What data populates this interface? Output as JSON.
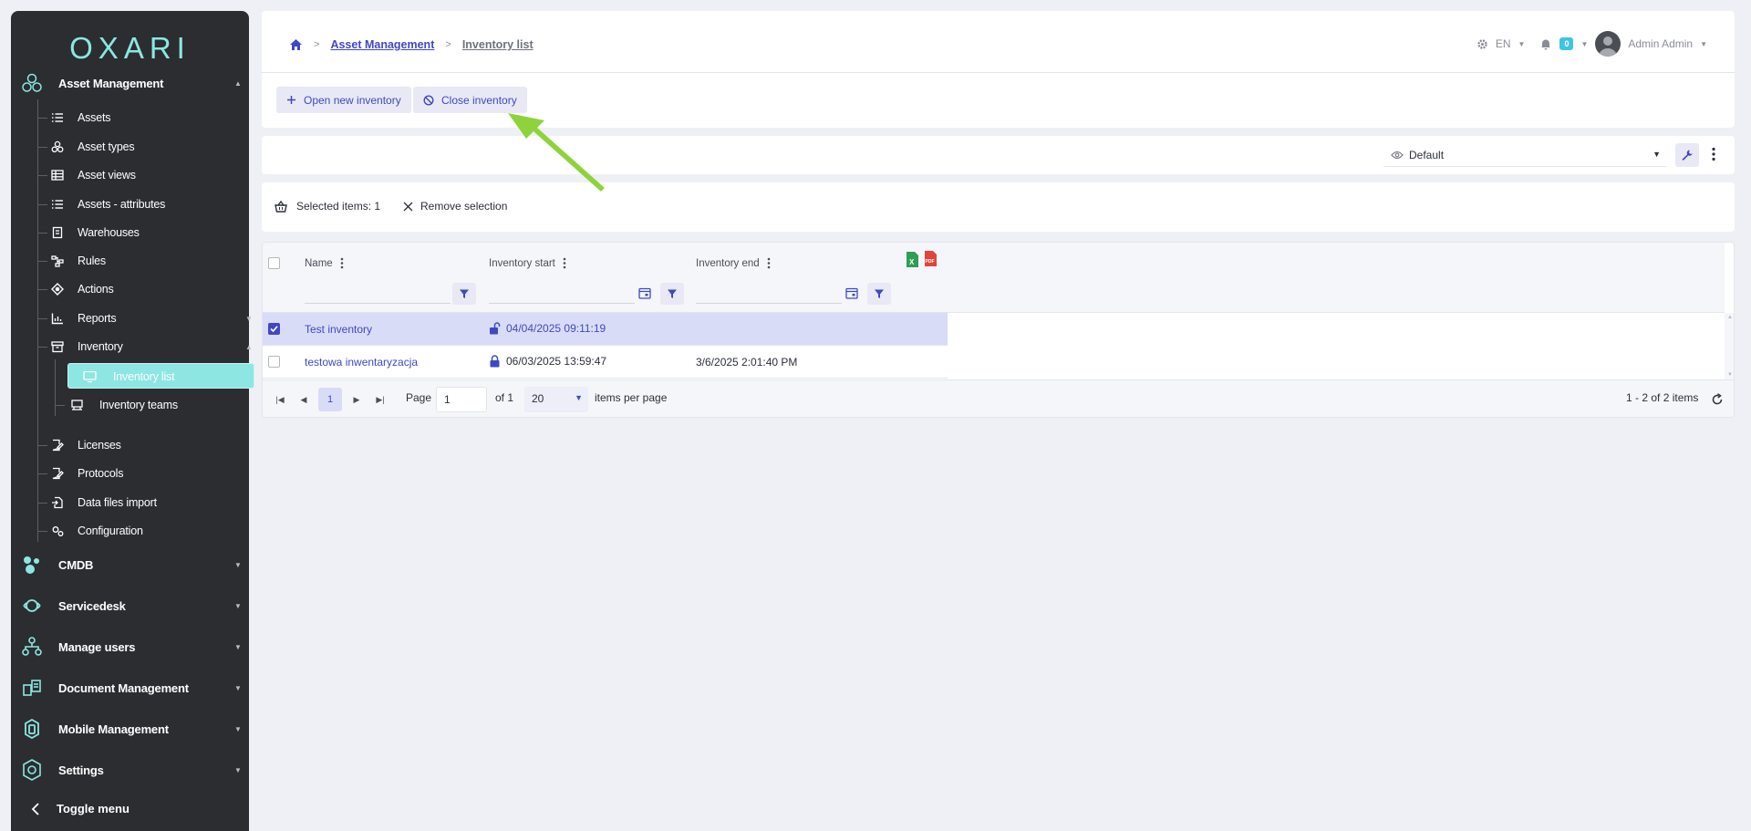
{
  "sidebar": {
    "logo": "OXARI",
    "sections": [
      {
        "label": "Asset Management",
        "icon": "asset-management-icon"
      },
      {
        "label": "CMDB",
        "icon": "cmdb-icon"
      },
      {
        "label": "Servicedesk",
        "icon": "servicedesk-icon"
      },
      {
        "label": "Manage users",
        "icon": "manage-users-icon"
      },
      {
        "label": "Document Management",
        "icon": "document-management-icon"
      },
      {
        "label": "Mobile Management",
        "icon": "mobile-management-icon"
      },
      {
        "label": "Settings",
        "icon": "settings-icon"
      }
    ],
    "items": [
      {
        "label": "Assets"
      },
      {
        "label": "Asset types"
      },
      {
        "label": "Asset views"
      },
      {
        "label": "Assets - attributes"
      },
      {
        "label": "Warehouses"
      },
      {
        "label": "Rules"
      },
      {
        "label": "Actions"
      },
      {
        "label": "Reports"
      },
      {
        "label": "Inventory"
      },
      {
        "label": "Licenses"
      },
      {
        "label": "Protocols"
      },
      {
        "label": "Data files import"
      },
      {
        "label": "Configuration"
      }
    ],
    "subitems": [
      {
        "label": "Inventory list"
      },
      {
        "label": "Inventory teams"
      }
    ],
    "toggle_label": "Toggle menu",
    "accent": "#8de6e2"
  },
  "header": {
    "breadcrumb": [
      "Asset Management",
      "Inventory list"
    ],
    "lang": "EN",
    "notifications": "0",
    "user": "Admin Admin"
  },
  "toolbar": {
    "open_label": "Open new inventory",
    "close_label": "Close inventory"
  },
  "view": {
    "selected": "Default"
  },
  "selection": {
    "selected_text": "Selected items: 1",
    "remove_label": "Remove selection"
  },
  "grid": {
    "columns": [
      "Name",
      "Inventory start",
      "Inventory end"
    ],
    "rows": [
      {
        "name": "Test inventory",
        "start": "04/04/2025 09:11:19",
        "end": "",
        "selected": true,
        "locked": false
      },
      {
        "name": "testowa inwentaryzacja",
        "start": "06/03/2025 13:59:47",
        "end": "3/6/2025 2:01:40 PM",
        "selected": false,
        "locked": true
      }
    ]
  },
  "pager": {
    "current_page": "1",
    "page_label": "Page",
    "page_value": "1",
    "of_label": "of 1",
    "per_page": "20",
    "per_page_label": "items per page",
    "summary": "1 - 2 of 2 items"
  },
  "colors": {
    "brand": "#3f48c4",
    "sidebar_bg": "#2b2d31",
    "arrow": "#8ed33b"
  }
}
